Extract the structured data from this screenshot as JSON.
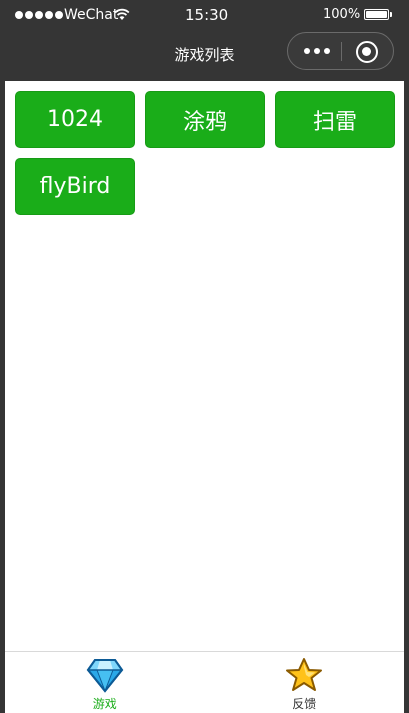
{
  "status_bar": {
    "carrier": "WeChat",
    "time": "15:30",
    "battery": "100%"
  },
  "nav": {
    "title": "游戏列表"
  },
  "games": [
    {
      "label": "1024"
    },
    {
      "label": "涂鸦"
    },
    {
      "label": "扫雷"
    },
    {
      "label": "flyBird"
    }
  ],
  "tabs": [
    {
      "label": "游戏",
      "icon": "diamond-icon",
      "active": true
    },
    {
      "label": "反馈",
      "icon": "star-icon",
      "active": false
    }
  ],
  "colors": {
    "accent": "#1aad19",
    "nav_bg": "#353535"
  }
}
